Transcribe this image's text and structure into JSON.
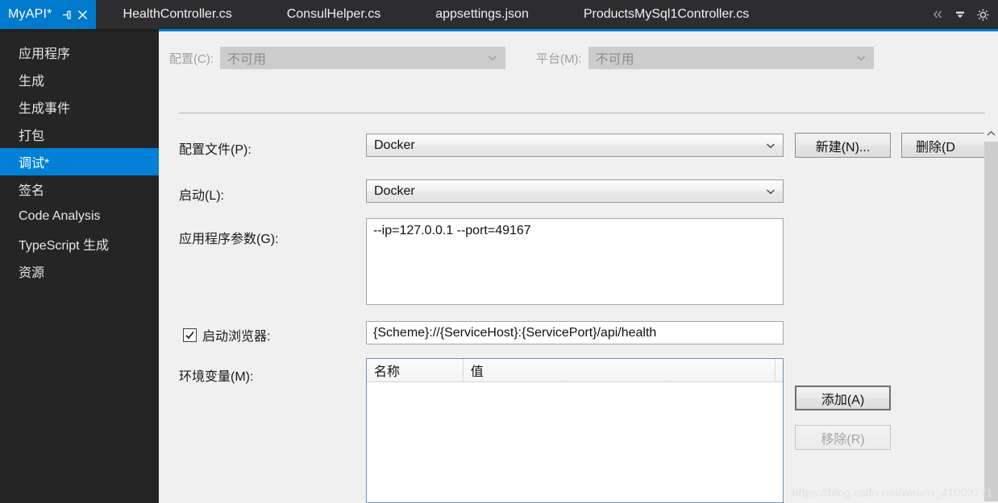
{
  "window": {
    "active_tab": {
      "title": "MyAPI*",
      "pin_icon": "pin-icon",
      "close_icon": "close-icon"
    },
    "tabs": [
      {
        "label": "HealthController.cs"
      },
      {
        "label": "ConsulHelper.cs"
      },
      {
        "label": "appsettings.json"
      },
      {
        "label": "ProductsMySql1Controller.cs"
      }
    ],
    "tools": [
      {
        "icon": "chevron-double-left-icon",
        "glyph": "«"
      },
      {
        "icon": "tab-list-dropdown-icon",
        "glyph": "▼"
      },
      {
        "icon": "gear-icon",
        "glyph": "⚙"
      }
    ],
    "accent_color": "#007acc"
  },
  "sidebar": {
    "items": [
      {
        "label": "应用程序",
        "selected": false
      },
      {
        "label": "生成",
        "selected": false
      },
      {
        "label": "生成事件",
        "selected": false
      },
      {
        "label": "打包",
        "selected": false
      },
      {
        "label": "调试*",
        "selected": true
      },
      {
        "label": "签名",
        "selected": false
      },
      {
        "label": "Code Analysis",
        "selected": false
      },
      {
        "label": "TypeScript 生成",
        "selected": false
      },
      {
        "label": "资源",
        "selected": false
      }
    ],
    "selected_color": "#0080d6",
    "background_color": "#252526"
  },
  "config_bar": {
    "configuration": {
      "label": "配置(C):",
      "value": "不可用",
      "disabled": true
    },
    "platform": {
      "label": "平台(M):",
      "value": "不可用",
      "disabled": true
    }
  },
  "form": {
    "profile": {
      "label": "配置文件(P):",
      "value": "Docker"
    },
    "launch": {
      "label": "启动(L):",
      "value": "Docker"
    },
    "app_arguments": {
      "label": "应用程序参数(G):",
      "value": "--ip=127.0.0.1 --port=49167"
    },
    "launch_browser": {
      "label": "启动浏览器:",
      "checked": true,
      "url": "{Scheme}://{ServiceHost}:{ServicePort}/api/health"
    },
    "environment_variables": {
      "label": "环境变量(M):",
      "columns": [
        "名称",
        "值"
      ],
      "rows": []
    }
  },
  "buttons": {
    "new_profile": "新建(N)...",
    "delete_profile": "删除(D",
    "add_env": "添加(A)",
    "remove_env": "移除(R)"
  },
  "scrollbar": {
    "up_arrow_icon": "chevron-up-icon"
  },
  "watermark": {
    "text": "https://blog.csdn.net/weixin_41003771"
  }
}
